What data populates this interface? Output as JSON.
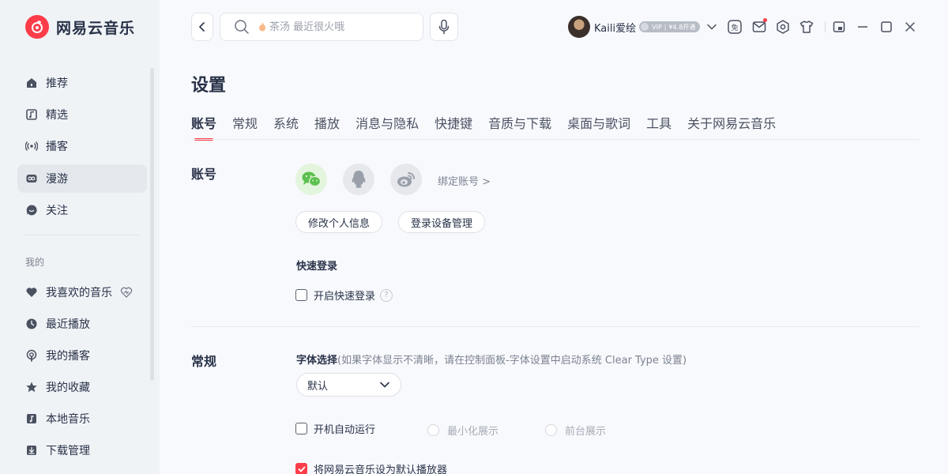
{
  "app": {
    "name": "网易云音乐"
  },
  "sidebar": {
    "items": [
      {
        "label": "推荐",
        "icon": "home-icon"
      },
      {
        "label": "精选",
        "icon": "music-note-icon"
      },
      {
        "label": "播客",
        "icon": "radio-icon"
      },
      {
        "label": "漫游",
        "icon": "roaming-icon",
        "active": true
      },
      {
        "label": "关注",
        "icon": "chat-bubble-icon"
      }
    ],
    "section_label": "我的",
    "my_items": [
      {
        "label": "我喜欢的音乐",
        "icon": "heart-icon"
      },
      {
        "label": "最近播放",
        "icon": "clock-icon"
      },
      {
        "label": "我的播客",
        "icon": "podcast-icon"
      },
      {
        "label": "我的收藏",
        "icon": "star-icon"
      },
      {
        "label": "本地音乐",
        "icon": "local-music-icon"
      },
      {
        "label": "下载管理",
        "icon": "download-icon"
      }
    ]
  },
  "topbar": {
    "search_placeholder": "茶汤 最近很火哦",
    "username": "Kaili爱绘",
    "vip_label": "VIP",
    "vip_promo": "¥4.8开通"
  },
  "settings": {
    "title": "设置",
    "tabs": [
      "账号",
      "常规",
      "系统",
      "播放",
      "消息与隐私",
      "快捷键",
      "音质与下载",
      "桌面与歌词",
      "工具",
      "关于网易云音乐"
    ],
    "account": {
      "section_title": "账号",
      "bind_link": "绑定账号 >",
      "edit_profile_button": "修改个人信息",
      "device_manage_button": "登录设备管理",
      "quick_login_title": "快速登录",
      "quick_login_checkbox": "开启快速登录",
      "help_mark": "?"
    },
    "general": {
      "section_title": "常规",
      "font_label": "字体选择",
      "font_hint": "(如果字体显示不清晰，请在控制面板-字体设置中启动系统 Clear Type 设置)",
      "font_value": "默认",
      "autostart_label": "开机自动运行",
      "minimize_label": "最小化展示",
      "foreground_label": "前台展示",
      "default_player_label": "将网易云音乐设为默认播放器"
    }
  },
  "colors": {
    "brand": "#fc3d49",
    "text": "#283248",
    "sidebar_bg": "#f0f3f6",
    "page_bg": "#f8f9fd"
  }
}
